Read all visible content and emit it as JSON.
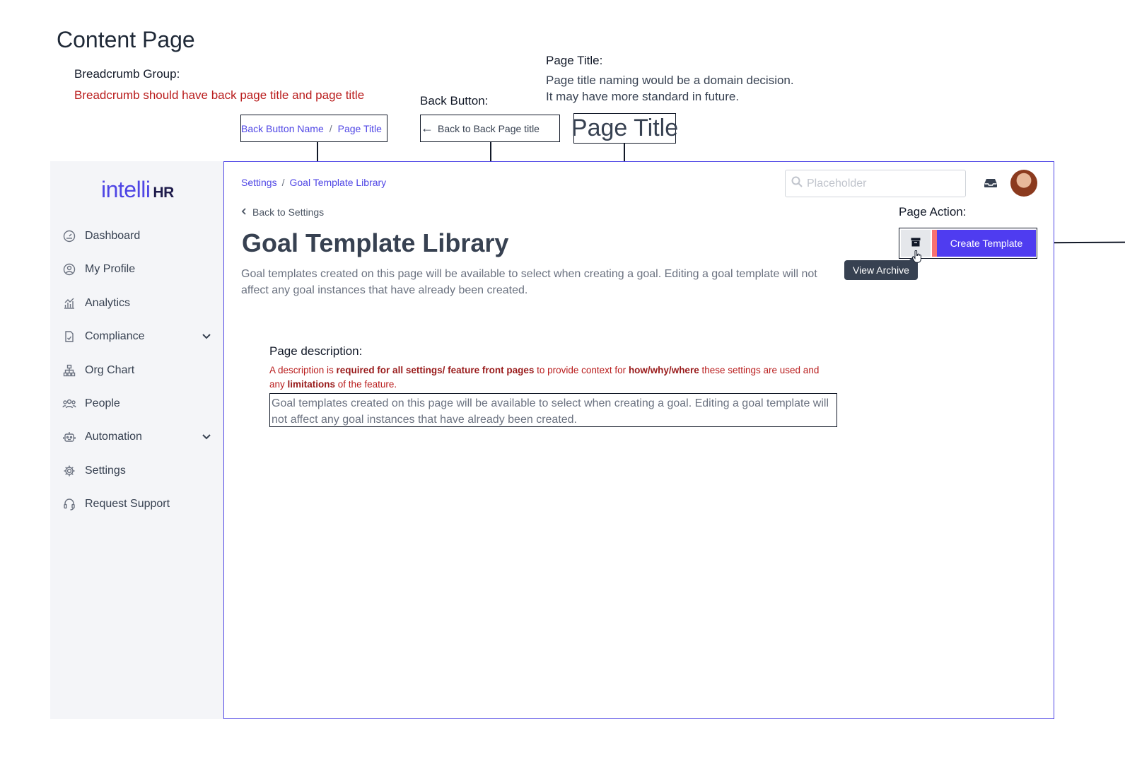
{
  "doc": {
    "title": "Content Page",
    "breadcrumb_group": {
      "heading": "Breadcrumb Group:",
      "note": "Breadcrumb should have back page title and page title",
      "sample_back": "Back Button Name",
      "sample_sep": "/",
      "sample_page": "Page Title"
    },
    "back_button": {
      "heading": "Back Button:",
      "sample": "Back to Back Page title"
    },
    "page_title": {
      "heading": "Page Title:",
      "line1": "Page title naming would be a domain decision.",
      "line2": "It may have more standard in future.",
      "sample": "Page Title"
    },
    "page_action": {
      "heading": "Page Action:"
    },
    "page_description": {
      "heading": "Page description:",
      "note_parts": [
        "A description is ",
        "required for all settings/ feature front pages",
        " to provide context for ",
        "how/why/where",
        " these settings are used and any ",
        "limitations",
        " of the feature."
      ],
      "sample": "Goal templates created on this page will be available to select when creating a goal. Editing a goal template will not affect any goal instances that have already been created."
    }
  },
  "app": {
    "logo": {
      "text": "intelli",
      "suffix": "HR"
    },
    "sidebar": {
      "items": [
        {
          "label": "Dashboard",
          "icon": "gauge-icon",
          "has_chevron": false
        },
        {
          "label": "My Profile",
          "icon": "user-circle-icon",
          "has_chevron": false
        },
        {
          "label": "Analytics",
          "icon": "analytics-icon",
          "has_chevron": false
        },
        {
          "label": "Compliance",
          "icon": "document-icon",
          "has_chevron": true
        },
        {
          "label": "Org Chart",
          "icon": "org-chart-icon",
          "has_chevron": false
        },
        {
          "label": "People",
          "icon": "people-icon",
          "has_chevron": false
        },
        {
          "label": "Automation",
          "icon": "robot-icon",
          "has_chevron": true
        },
        {
          "label": "Settings",
          "icon": "gear-icon",
          "has_chevron": false
        },
        {
          "label": "Request Support",
          "icon": "headset-icon",
          "has_chevron": false
        }
      ]
    },
    "header": {
      "search_placeholder": "Placeholder"
    },
    "breadcrumb": {
      "parent": "Settings",
      "sep": "/",
      "current": "Goal Template Library"
    },
    "back_link": "Back to Settings",
    "page_title": "Goal Template Library",
    "page_description": "Goal templates created on this page will be available to select when creating a goal. Editing a goal template will not affect any goal instances that have already been created.",
    "actions": {
      "archive_tooltip": "View Archive",
      "create_label": "Create Template"
    },
    "colors": {
      "accent": "#4f46e5",
      "primary_button": "#4f3cf0",
      "annotation_red": "#b91c1c"
    }
  }
}
